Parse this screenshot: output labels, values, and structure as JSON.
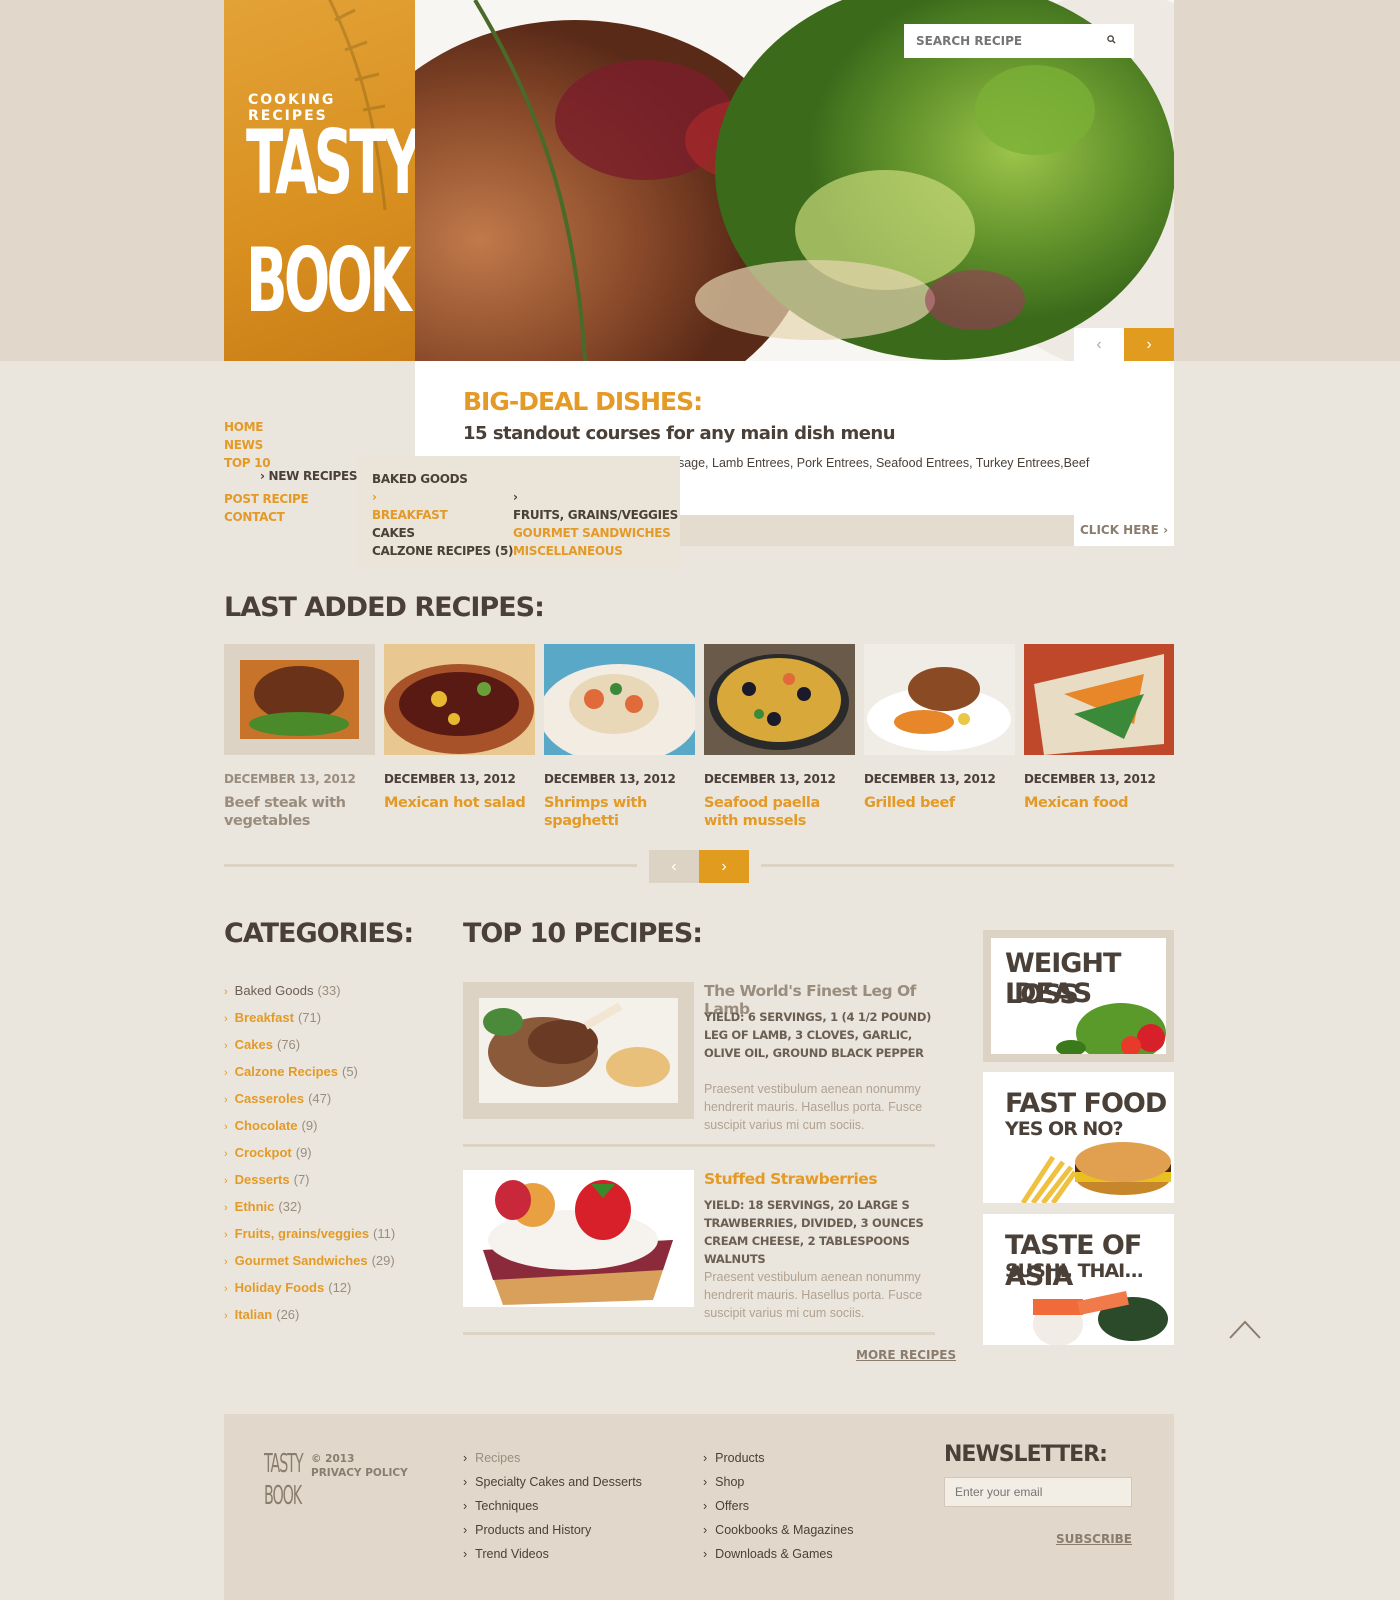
{
  "brand": {
    "subtitle": "COOKING RECIPES",
    "name": "TASTY BOOK",
    "name_line1": "TASTY",
    "name_line2": "BOOK"
  },
  "search": {
    "placeholder": "SEARCH RECIPE"
  },
  "hero": {
    "prev_icon": "chevron-left-icon",
    "next_icon": "chevron-right-icon"
  },
  "feature": {
    "title": "BIG-DEAL DISHES:",
    "subtitle": "15 standout courses for any main dish menu",
    "text": "usage, Lamb Entrees, Pork Entrees, Seafood Entrees, Turkey Entrees,Beef",
    "cta": "CLICK HERE"
  },
  "nav": {
    "items": [
      "HOME",
      "NEWS",
      "TOP 10",
      "POST RECIPE",
      "CONTACT"
    ],
    "submenu_open": "NEW RECIPES",
    "dropdown_col1": [
      "BAKED GOODS",
      "BREAKFAST",
      "CAKES",
      "CALZONE RECIPES (5)"
    ],
    "dropdown_col2": [
      "FRUITS, GRAINS/VEGGIES",
      "GOURMET SANDWICHES",
      "MISCELLANEOUS"
    ]
  },
  "last_added": {
    "title": "LAST ADDED RECIPES:",
    "items": [
      {
        "date": "DECEMBER 13, 2012",
        "name": "Beef steak with vegetables"
      },
      {
        "date": "DECEMBER 13, 2012",
        "name": "Mexican hot salad"
      },
      {
        "date": "DECEMBER 13, 2012",
        "name": "Shrimps  with spaghetti"
      },
      {
        "date": "DECEMBER 13, 2012",
        "name": "Seafood paella with mussels"
      },
      {
        "date": "DECEMBER 13, 2012",
        "name": "Grilled beef"
      },
      {
        "date": "DECEMBER 13, 2012",
        "name": "Mexican food"
      }
    ]
  },
  "categories": {
    "title": "CATEGORIES:",
    "items": [
      {
        "label": "Baked Goods",
        "count": "(33)"
      },
      {
        "label": "Breakfast",
        "count": "(71)"
      },
      {
        "label": "Cakes",
        "count": "(76)"
      },
      {
        "label": "Calzone Recipes",
        "count": "(5)"
      },
      {
        "label": "Casseroles",
        "count": "(47)"
      },
      {
        "label": "Chocolate",
        "count": "(9)"
      },
      {
        "label": "Crockpot",
        "count": "(9)"
      },
      {
        "label": "Desserts",
        "count": "(7)"
      },
      {
        "label": "Ethnic",
        "count": "(32)"
      },
      {
        "label": "Fruits, grains/veggies",
        "count": "(11)"
      },
      {
        "label": "Gourmet Sandwiches",
        "count": "(29)"
      },
      {
        "label": "Holiday Foods",
        "count": "(12)"
      },
      {
        "label": "Italian",
        "count": "(26)"
      }
    ]
  },
  "top10": {
    "title": "TOP 10 PECIPES:",
    "items": [
      {
        "title": "The World's Finest Leg Of Lamb",
        "yield": "YIELD: 6 SERVINGS, 1 (4 1/2 POUND) LEG OF LAMB, 3 CLOVES, GARLIC, OLIVE OIL, GROUND BLACK PEPPER",
        "desc": "Praesent vestibulum aenean nonummy hendrerit mauris. Hasellus porta. Fusce suscipit varius mi cum sociis."
      },
      {
        "title": "Stuffed Strawberries",
        "yield": "YIELD: 18 SERVINGS, 20 LARGE S TRAWBERRIES, DIVIDED, 3 OUNCES CREAM CHEESE, 2 TABLESPOONS WALNUTS",
        "desc": "Praesent vestibulum aenean nonummy hendrerit mauris. Hasellus porta. Fusce suscipit varius mi cum sociis."
      }
    ],
    "more": "MORE RECIPES"
  },
  "promos": [
    {
      "line1": "WEIGHT LOSS",
      "line2": "IDEAS"
    },
    {
      "line1": "FAST FOOD",
      "line2": "YES OR NO?"
    },
    {
      "line1": "TASTE OF ASIA",
      "line2": "SUSHI, THAI..."
    }
  ],
  "footer": {
    "logo_line1": "TASTY",
    "logo_line2": "BOOK",
    "copyright": "© 2013",
    "privacy": "PRIVACY POLICY",
    "col1": [
      "Recipes",
      "Specialty Cakes and Desserts",
      "Techniques",
      "Products and History",
      "Trend Videos"
    ],
    "col2": [
      "Products",
      "Shop",
      "Offers",
      "Cookbooks & Magazines",
      "Downloads & Games"
    ],
    "newsletter_title": "NEWSLETTER:",
    "email_placeholder": "Enter your email",
    "subscribe": "SUBSCRIBE"
  },
  "colors": {
    "accent": "#e19b1f",
    "text": "#4a4038",
    "background": "#ebe6dd",
    "band": "#e1d8cb"
  }
}
